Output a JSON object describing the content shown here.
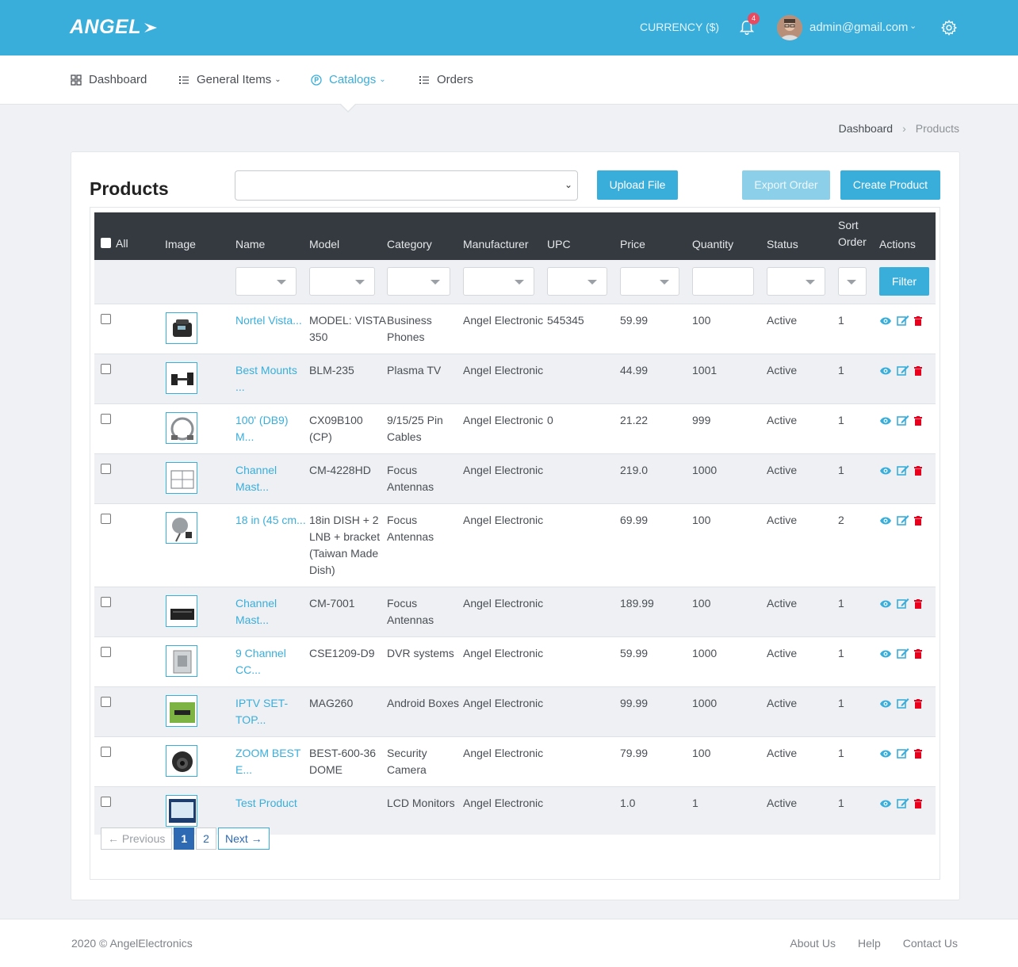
{
  "header": {
    "logo": "ANGEL",
    "currency": "CURRENCY ($)",
    "notification_count": "4",
    "user_email": "admin@gmail.com"
  },
  "nav": {
    "items": [
      {
        "label": "Dashboard",
        "icon": "grid-icon"
      },
      {
        "label": "General Items",
        "icon": "list-icon"
      },
      {
        "label": "Catalogs",
        "icon": "catalog-icon",
        "active": true
      },
      {
        "label": "Orders",
        "icon": "list-icon"
      }
    ]
  },
  "breadcrumb": {
    "home": "Dashboard",
    "current": "Products"
  },
  "page": {
    "title": "Products",
    "upload_label": "Upload File",
    "export_label": "Export Order",
    "create_label": "Create Product",
    "filter_label": "Filter"
  },
  "table": {
    "columns": [
      "All",
      "Image",
      "Name",
      "Model",
      "Category",
      "Manufacturer",
      "UPC",
      "Price",
      "Quantity",
      "Status",
      "Sort Order",
      "Actions"
    ],
    "rows": [
      {
        "name": "Nortel Vista...",
        "model": "MODEL: VISTA 350",
        "category": "Business Phones",
        "manufacturer": "Angel Electronic",
        "upc": "545345",
        "price": "59.99",
        "quantity": "100",
        "status": "Active",
        "sort": "1"
      },
      {
        "name": "Best Mounts ...",
        "model": "BLM-235",
        "category": "Plasma TV",
        "manufacturer": "Angel Electronic",
        "upc": "",
        "price": "44.99",
        "quantity": "1001",
        "status": "Active",
        "sort": "1"
      },
      {
        "name": "100' (DB9) M...",
        "model": "CX09B100 (CP)",
        "category": "9/15/25 Pin Cables",
        "manufacturer": "Angel Electronic",
        "upc": "0",
        "price": "21.22",
        "quantity": "999",
        "status": "Active",
        "sort": "1"
      },
      {
        "name": "Channel Mast...",
        "model": "CM-4228HD",
        "category": "Focus Antennas",
        "manufacturer": "Angel Electronic",
        "upc": "",
        "price": "219.0",
        "quantity": "1000",
        "status": "Active",
        "sort": "1"
      },
      {
        "name": "18 in (45 cm...",
        "model": "18in DISH + 2 LNB + bracket (Taiwan Made Dish)",
        "category": "Focus Antennas",
        "manufacturer": "Angel Electronic",
        "upc": "",
        "price": "69.99",
        "quantity": "100",
        "status": "Active",
        "sort": "2"
      },
      {
        "name": "Channel Mast...",
        "model": "CM-7001",
        "category": "Focus Antennas",
        "manufacturer": "Angel Electronic",
        "upc": "",
        "price": "189.99",
        "quantity": "100",
        "status": "Active",
        "sort": "1"
      },
      {
        "name": "9 Channel CC...",
        "model": "CSE1209-D9",
        "category": "DVR systems",
        "manufacturer": "Angel Electronic",
        "upc": "",
        "price": "59.99",
        "quantity": "1000",
        "status": "Active",
        "sort": "1"
      },
      {
        "name": "IPTV SET-TOP...",
        "model": "MAG260",
        "category": "Android Boxes",
        "manufacturer": "Angel Electronic",
        "upc": "",
        "price": "99.99",
        "quantity": "1000",
        "status": "Active",
        "sort": "1"
      },
      {
        "name": "ZOOM BEST E...",
        "model": "BEST-600-36 DOME",
        "category": "Security Camera",
        "manufacturer": "Angel Electronic",
        "upc": "",
        "price": "79.99",
        "quantity": "100",
        "status": "Active",
        "sort": "1"
      },
      {
        "name": "Test Product",
        "model": "",
        "category": "LCD Monitors",
        "manufacturer": "Angel Electronic",
        "upc": "",
        "price": "1.0",
        "quantity": "1",
        "status": "Active",
        "sort": "1"
      }
    ]
  },
  "pagination": {
    "prev": "← Previous",
    "pages": [
      "1",
      "2"
    ],
    "current": "1",
    "next": "Next →"
  },
  "footer": {
    "copyright": "2020 © AngelElectronics",
    "links": [
      "About Us",
      "Help",
      "Contact Us"
    ]
  },
  "colors": {
    "primary": "#3aaedb",
    "header_dark": "#343a40",
    "danger": "#e8001c",
    "badge": "#e84a5f"
  }
}
